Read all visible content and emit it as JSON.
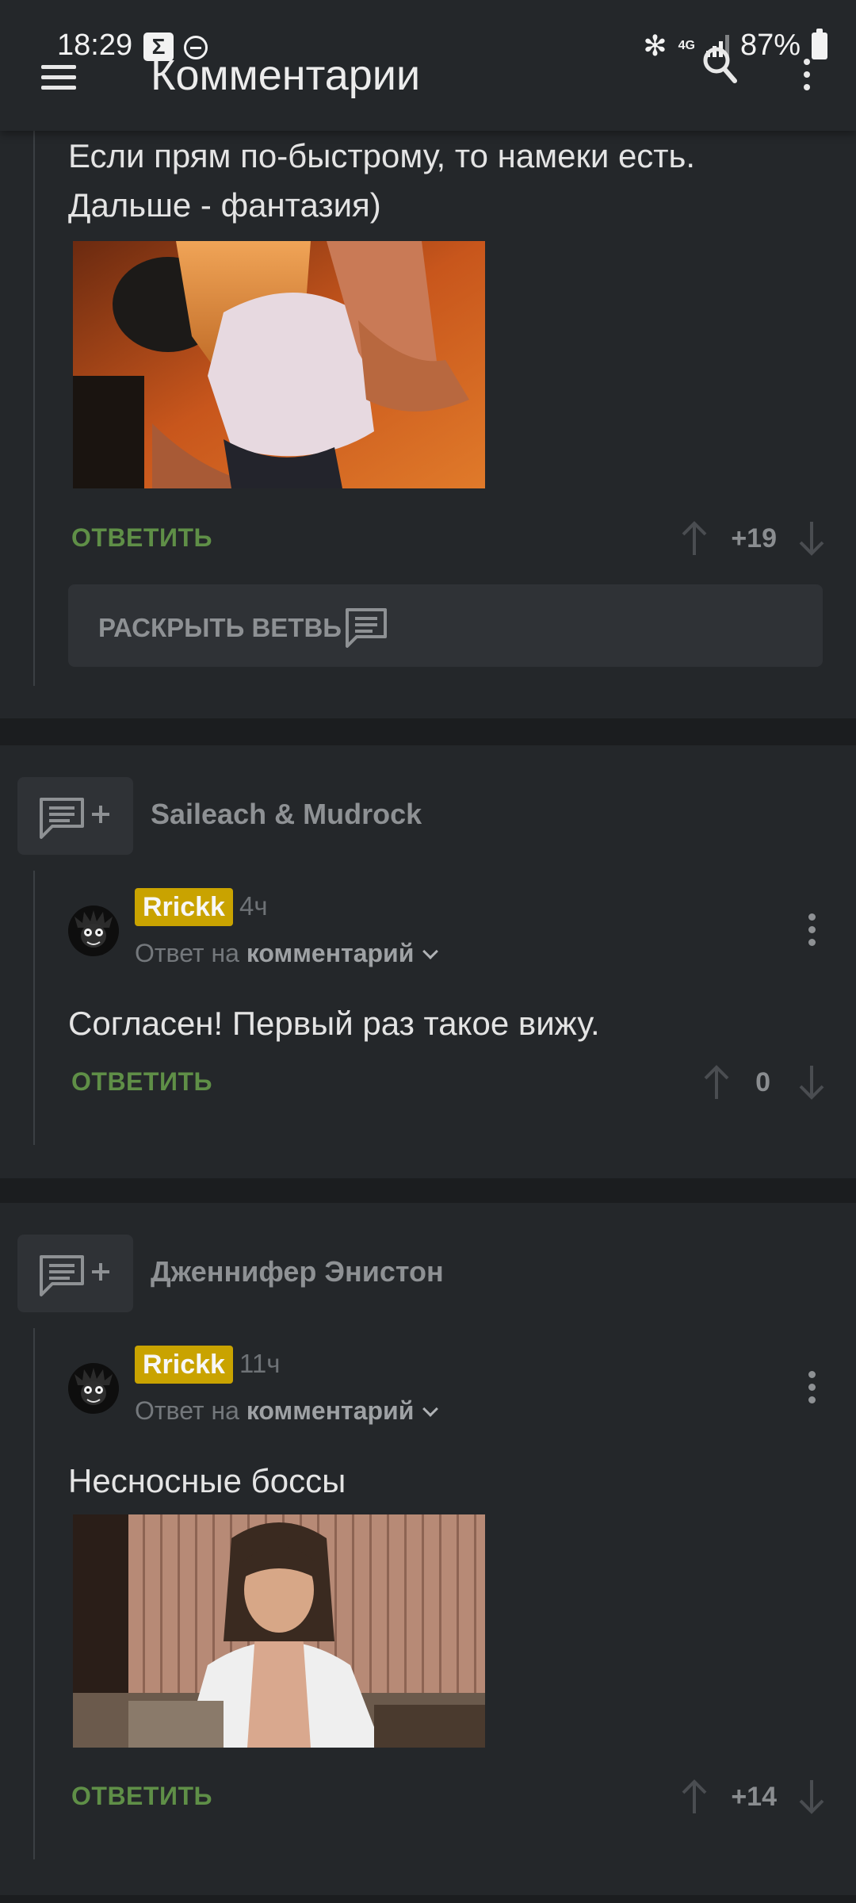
{
  "status_bar": {
    "time": "18:29",
    "notif_letter": "Σ",
    "network": "4G",
    "battery": "87%"
  },
  "header": {
    "title": "Комментарии"
  },
  "comment_top": {
    "text_line1": "Если прям по-быстрому, то намеки есть.",
    "text_line2": "Дальше - фантазия)",
    "reply_label": "ОТВЕТИТЬ",
    "score": "+19",
    "expand_label": "РАСКРЫТЬ ВЕТВЬ"
  },
  "comment_2": {
    "parent_author": "Saileach & Mudrock",
    "user": "Rrickk",
    "time": "4ч",
    "reply_to_prefix": "Ответ на",
    "reply_to_target": "комментарий",
    "text": "Согласен! Первый раз такое вижу.",
    "reply_label": "ОТВЕТИТЬ",
    "score": "0"
  },
  "comment_3": {
    "parent_author": "Дженнифер Энистон",
    "user": "Rrickk",
    "time": "11ч",
    "reply_to_prefix": "Ответ на",
    "reply_to_target": "комментарий",
    "text": "Несносные боссы",
    "reply_label": "ОТВЕТИТЬ",
    "score": "+14"
  },
  "colors": {
    "background": "#1b1d1f",
    "card": "#24272a",
    "reply_green": "#5f8f47",
    "username_badge": "#c9a300"
  }
}
